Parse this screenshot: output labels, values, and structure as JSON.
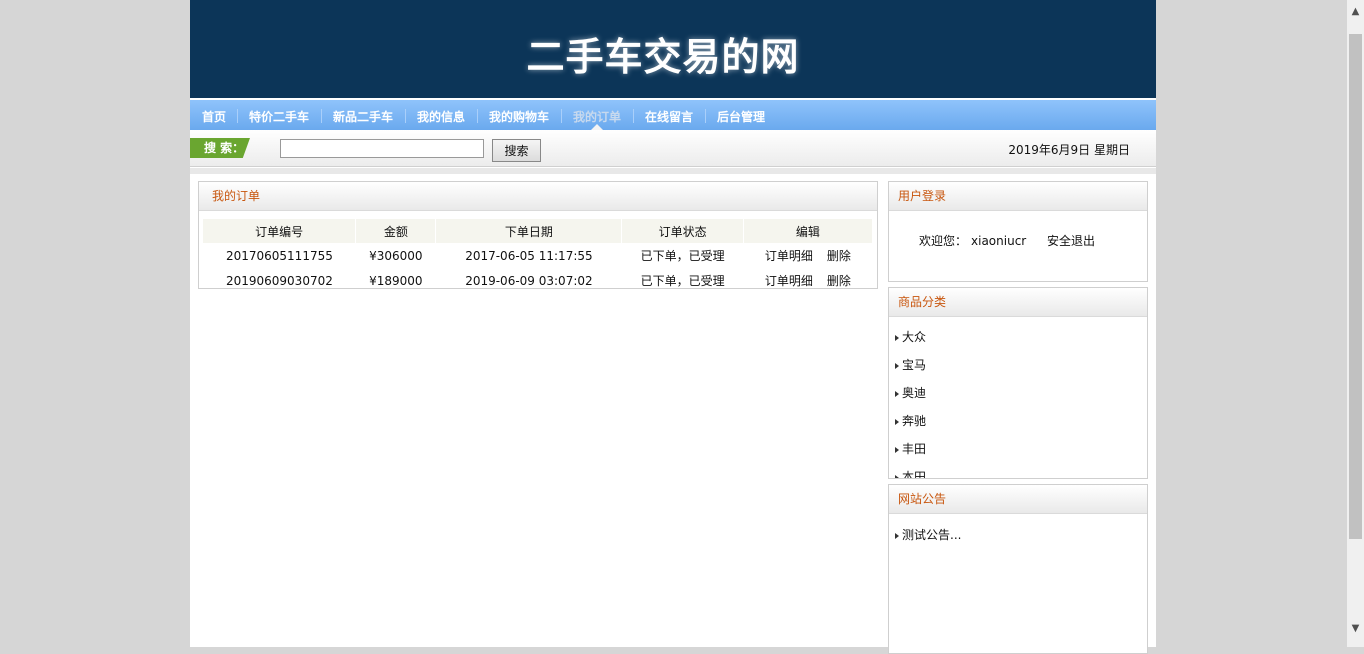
{
  "header": {
    "title": "二手车交易的网"
  },
  "nav": {
    "items": [
      {
        "label": "首页",
        "active": false
      },
      {
        "label": "特价二手车",
        "active": false
      },
      {
        "label": "新品二手车",
        "active": false
      },
      {
        "label": "我的信息",
        "active": false
      },
      {
        "label": "我的购物车",
        "active": false
      },
      {
        "label": "我的订单",
        "active": true
      },
      {
        "label": "在线留言",
        "active": false
      },
      {
        "label": "后台管理",
        "active": false
      }
    ]
  },
  "search": {
    "label": "搜 索：",
    "value": "",
    "placeholder": "",
    "button_label": "搜索",
    "date_text": "2019年6月9日 星期日"
  },
  "orders": {
    "title": "我的订单",
    "columns": [
      "订单编号",
      "金额",
      "下单日期",
      "订单状态",
      "编辑"
    ],
    "rows": [
      {
        "id": "20170605111755",
        "amount": "¥306000",
        "date": "2017-06-05 11:17:55",
        "status": "已下单，已受理",
        "detail_label": "订单明细",
        "delete_label": "删除"
      },
      {
        "id": "20190609030702",
        "amount": "¥189000",
        "date": "2019-06-09 03:07:02",
        "status": "已下单，已受理",
        "detail_label": "订单明细",
        "delete_label": "删除"
      }
    ]
  },
  "login": {
    "title": "用户登录",
    "welcome_prefix": "欢迎您：",
    "username": "xiaoniucr",
    "logout_label": "安全退出"
  },
  "categories": {
    "title": "商品分类",
    "items": [
      "大众",
      "宝马",
      "奥迪",
      "奔驰",
      "丰田",
      "本田"
    ]
  },
  "notices": {
    "title": "网站公告",
    "items": [
      "测试公告..."
    ]
  },
  "colors": {
    "header_bg": "#0c3558",
    "nav_bg": "#7ab4f5",
    "panel_title": "#c8560e",
    "search_label_bg": "#6aa630"
  }
}
